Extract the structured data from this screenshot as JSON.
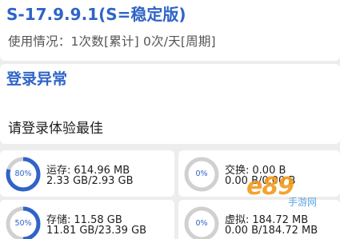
{
  "header": {
    "version": "S-17.9.9.1(S=稳定版)",
    "usage": "使用情况：1次数[累计]  0次/天[周期]"
  },
  "login": {
    "title": "登录异常",
    "hint": "请登录体验最佳"
  },
  "stats": {
    "memory": {
      "percent_label": "80%",
      "percent": 80,
      "label": "运存:",
      "used": "614.96 MB",
      "detail": "2.33 GB/2.93 GB"
    },
    "swap": {
      "percent_label": "0%",
      "percent": 0,
      "label": "交换:",
      "used": "0.00 B",
      "detail": "0.00 B/0.00 B"
    },
    "storage": {
      "percent_label": "50%",
      "percent": 50,
      "label": "存储:",
      "used": "11.58 GB",
      "detail": "11.81 GB/23.39 GB"
    },
    "virtual": {
      "percent_label": "0%",
      "percent": 0,
      "label": "虚拟:",
      "used": "184.72 MB",
      "detail": "0.00 B/184.72 MB"
    }
  },
  "colors": {
    "accent": "#2f64c8",
    "ring_track": "#d0d0d0",
    "background": "#ededed"
  },
  "watermark": {
    "text": "e89",
    "sub": "手游网"
  }
}
